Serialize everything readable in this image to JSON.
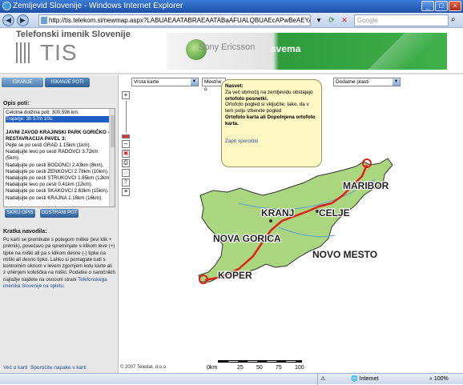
{
  "window": {
    "title": "Zemljevid Slovenije - Windows Internet Explorer"
  },
  "address": {
    "url": "http://tis.telekom.si/newmap.aspx?LABUAEAATABRAEAATABaAFUALQBUAEcAPwBeAEYAR...",
    "search_placeholder": "Google"
  },
  "header": {
    "brand": "Telefonski imenik Slovenije",
    "logo_word": "TIS",
    "banner_se": "Sony Ericsson",
    "banner_svema": "svema"
  },
  "left": {
    "tabs": [
      "ISKANJE",
      "ISKANJE POTI"
    ],
    "route_title": "Opis poti:",
    "route_lines": [
      {
        "t": "Celotna dolžina poti: 300,596 km.",
        "c": ""
      },
      {
        "t": "Trajanje: 3h 57m 10s.",
        "c": "hl"
      },
      {
        "t": "",
        "c": ""
      },
      {
        "t": "JAVNI ZAVOD KRAJINSKI PARK GORIČKO - RESTAVRACIJA PAVEL 3:",
        "c": "bold"
      },
      {
        "t": "Pejte se po cesti GRAD 1.15km (1km).",
        "c": ""
      },
      {
        "t": "Nadaljujte levo po cesti RADOVCI 3.72km (5km).",
        "c": ""
      },
      {
        "t": "Nadaljujte po cesti BODONCI 2.43km (8km).",
        "c": ""
      },
      {
        "t": "Nadaljujte po cesti ZENKOVCI 2.78km (10km).",
        "c": ""
      },
      {
        "t": "Nadaljujte po cesti STRUKOVCI 1.85km (12km).",
        "c": ""
      },
      {
        "t": "Nadaljujte levo po cesti 0.41km (12km).",
        "c": ""
      },
      {
        "t": "Nadaljujte po cesti SKAKOVCI 2.63km (15km).",
        "c": ""
      },
      {
        "t": "Nadaljujte po cesti KRAJNA 1.16km (16km).",
        "c": ""
      }
    ],
    "btn_hide": "SKRIJ OPIS",
    "btn_remove": "ODSTRANI POT",
    "instr_title": "Kratka navodila:",
    "instr_text": "Po karti se premikate s potegom miške (levi klik + premik), povečavo pa spreminjate s klikom leve (+) tipke na miški ali pa s klikom desne (-) tipke na miški ali desno tipko. Lahko si pomagate tudi s kontrolnim oknom v levem zgornjem kotu karte ali z vrtenjem koleščka na miški. Podatke o naročnikih najlažje najdete na osnovni strani ",
    "instr_link": "Telefonskega imenika Slovenije na spletu.",
    "footer1": "Več o karti",
    "footer2": "Sporočite napake v karti"
  },
  "map": {
    "selects": [
      "Vrsta karte",
      "Mestne o",
      "Dodatne plasti"
    ],
    "note_title": "Nasvet:",
    "note_l1": "Za več območij na zemljevidu obstajajo",
    "note_l2": "ortofoto posnetki.",
    "note_l3": "Ortofoto pogled si vključite, tako, da v tem polju izberete pogled",
    "note_l4": "Ortofoto karta ali Dopolnjena ortofoto karta.",
    "note_close": "Zapri sporočilo",
    "cities": [
      "MARIBOR",
      "KRANJ",
      "CELJE",
      "NOVA GORICA",
      "NOVO MESTO",
      "KOPER"
    ],
    "copyright": "© 2007 Teledat, d.o.o.",
    "scale": [
      "0km",
      "25",
      "50",
      "75",
      "100"
    ],
    "colors": {
      "land": "#a9d67e",
      "route": "#e0201a",
      "border": "#333333"
    }
  },
  "status": {
    "zone": "Internet",
    "zoom": "100%"
  }
}
